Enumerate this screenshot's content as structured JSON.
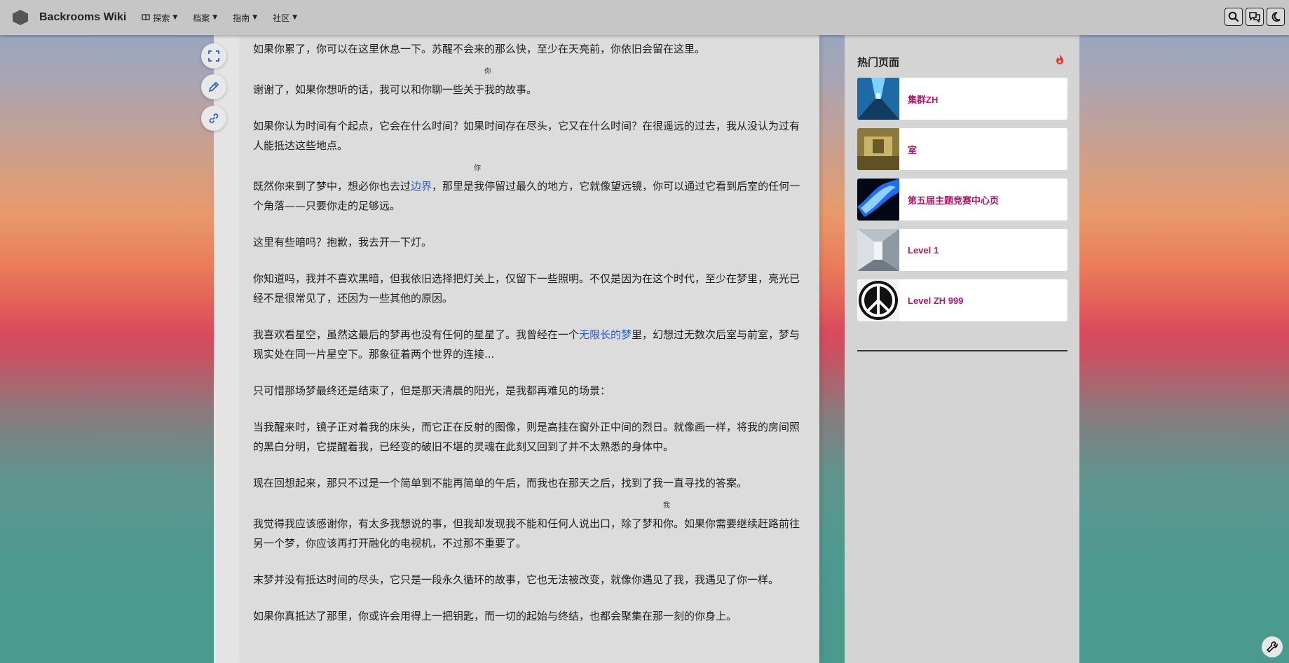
{
  "header": {
    "brand": "Backrooms Wiki",
    "nav": [
      {
        "label": "探索",
        "icon": "book-icon"
      },
      {
        "label": "档案"
      },
      {
        "label": "指南"
      },
      {
        "label": "社区"
      }
    ],
    "right_icons": [
      "search-icon",
      "chat-icon",
      "moon-icon"
    ]
  },
  "floating_tools": [
    "fullscreen-icon",
    "edit-icon",
    "link-icon"
  ],
  "article": {
    "paragraphs": [
      {
        "text": "如果你累了，你可以在这里休息一下。苏醒不会来的那么快，至少在天亮前，你依旧会留在这里。"
      },
      {
        "before": "谢谢了，如果你想听的话，我可以和你聊一些关于",
        "ruby_base": "我",
        "ruby_note": "你",
        "after": "的故事。"
      },
      {
        "text": "如果你认为时间有个起点，它会在什么时间？如果时间存在尽头，它又在什么时间？在很遥远的过去，我从没认为过有人能抵达这些地点。"
      },
      {
        "before": "既然你来到了梦中，想必你也去过",
        "link": "边界",
        "mid": "，那里是",
        "ruby_base": "我",
        "ruby_note": "你",
        "after": "停留过最久的地方，它就像望远镜，你可以通过它看到后室的任何一个角落——只要你走的足够远。"
      },
      {
        "text": "这里有些暗吗？抱歉，我去开一下灯。"
      },
      {
        "text": "你知道吗，我并不喜欢黑暗，但我依旧选择把灯关上，仅留下一些照明。不仅是因为在这个时代，至少在梦里，亮光已经不是很常见了，还因为一些其他的原因。"
      },
      {
        "before": "我喜欢看星空，虽然这最后的梦再也没有任何的星星了。我曾经在一个",
        "link": "无限长的梦",
        "after": "里，幻想过无数次后室与前室，梦与现实处在同一片星空下。那象征着两个世界的连接..."
      },
      {
        "text": "只可惜那场梦最终还是结束了，但是那天清晨的阳光，是我都再难见的场景："
      },
      {
        "text": "当我醒来时，镜子正对着我的床头，而它正在反射的图像，则是高挂在窗外正中间的烈日。就像画一样，将我的房间照的黑白分明，它提醒着我，已经变的破旧不堪的灵魂在此刻又回到了并不太熟悉的身体中。"
      },
      {
        "text": "现在回想起来，那只不过是一个简单到不能再简单的午后，而我也在那天之后，找到了我一直寻找的答案。"
      },
      {
        "before": "我觉得我应该感谢你，有太多我想说的事，但我却发现我不能和任何人说出口，除了梦和",
        "ruby_base": "你",
        "ruby_note": "我",
        "after": "。如果你需要继续赶路前往另一个梦，你应该再打开融化的电视机，不过那不重要了。"
      },
      {
        "text": "末梦并没有抵达时间的尽头，它只是一段永久循环的故事，它也无法被改变，就像你遇见了我，我遇见了你一样。"
      },
      {
        "text": "如果你真抵达了那里，你或许会用得上一把钥匙，而一切的起始与终结，也都会聚集在那一刻的你身上。"
      }
    ]
  },
  "sidebar": {
    "title": "热门页面",
    "items": [
      {
        "label": "集群ZH",
        "thumb": "blue-corridor"
      },
      {
        "label": "室",
        "thumb": "yellow-room"
      },
      {
        "label": "第五届主题竞赛中心页",
        "thumb": "blue-glow"
      },
      {
        "label": "Level 1",
        "thumb": "grey-hallway"
      },
      {
        "label": "Level ZH 999",
        "thumb": "peace-symbol"
      }
    ]
  },
  "colors": {
    "link": "#2c5bd1",
    "trending_label": "#b0176a",
    "fire": "#e2334a"
  }
}
